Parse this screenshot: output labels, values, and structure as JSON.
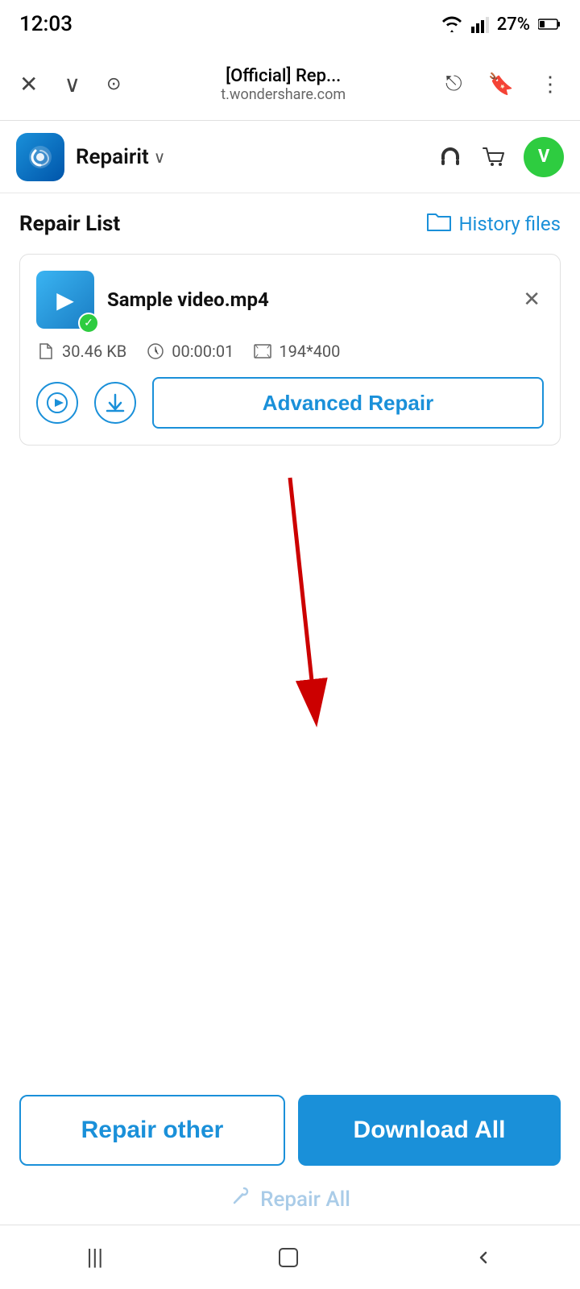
{
  "status": {
    "time": "12:03",
    "battery": "27%",
    "wifi": "WiFi",
    "signal": "Signal"
  },
  "browser": {
    "title": "[Official] Rep...",
    "url": "t.wondershare.com",
    "close_label": "×",
    "back_label": "✓",
    "filter_label": "⊙"
  },
  "app": {
    "name": "Repairit",
    "avatar_letter": "V"
  },
  "repair_list": {
    "title": "Repair List",
    "history_files": "History files"
  },
  "video_card": {
    "filename": "Sample video.mp4",
    "size": "30.46 KB",
    "duration": "00:00:01",
    "resolution": "194*400",
    "advanced_repair_label": "Advanced Repair"
  },
  "bottom": {
    "repair_other_label": "Repair other",
    "download_all_label": "Download All",
    "repair_all_label": "Repair All"
  },
  "nav": {
    "menu_label": "|||",
    "home_label": "○",
    "back_label": "‹"
  }
}
